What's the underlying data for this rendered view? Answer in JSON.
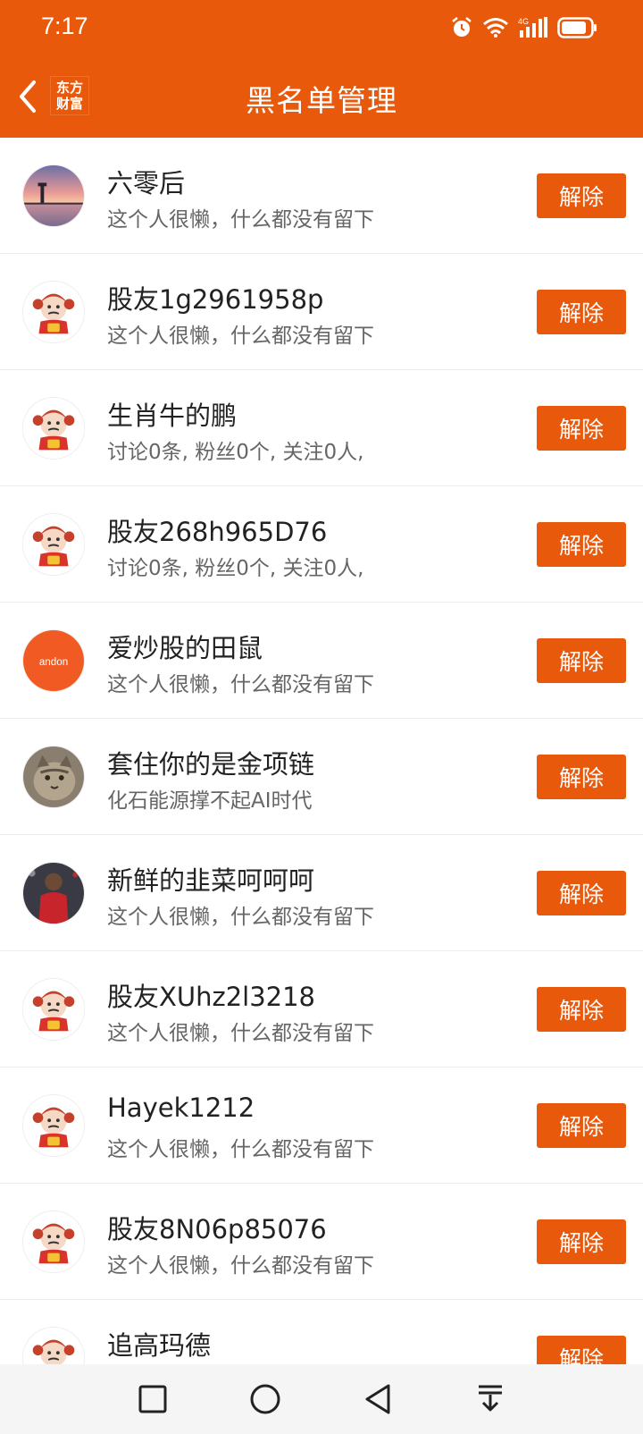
{
  "status_bar": {
    "time": "7:17",
    "network": "4G",
    "icons": [
      "alarm-icon",
      "wifi-icon",
      "signal-icon",
      "battery-icon"
    ]
  },
  "header": {
    "title": "黑名单管理",
    "brand_line1": "东方",
    "brand_line2": "财富",
    "accent_color": "#e8590b"
  },
  "blacklist": [
    {
      "name": "六零后",
      "desc": "这个人很懒，什么都没有留下",
      "button": "解除",
      "avatar": "sunset-photo"
    },
    {
      "name": "股友1g2961958p",
      "desc": "这个人很懒，什么都没有留下",
      "button": "解除",
      "avatar": "default-mascot"
    },
    {
      "name": "生肖牛的鹏",
      "desc": "讨论0条, 粉丝0个, 关注0人,",
      "button": "解除",
      "avatar": "default-mascot"
    },
    {
      "name": "股友268h965D76",
      "desc": "讨论0条, 粉丝0个, 关注0人,",
      "button": "解除",
      "avatar": "default-mascot"
    },
    {
      "name": "爱炒股的田鼠",
      "desc": "这个人很懒，什么都没有留下",
      "button": "解除",
      "avatar": "andon-logo"
    },
    {
      "name": "套住你的是金项链",
      "desc": "化石能源撑不起AI时代",
      "button": "解除",
      "avatar": "cat-photo"
    },
    {
      "name": "新鲜的韭菜呵呵呵",
      "desc": "这个人很懒，什么都没有留下",
      "button": "解除",
      "avatar": "player-photo"
    },
    {
      "name": "股友XUhz2l3218",
      "desc": "这个人很懒，什么都没有留下",
      "button": "解除",
      "avatar": "default-mascot"
    },
    {
      "name": "Hayek1212",
      "desc": "这个人很懒，什么都没有留下",
      "button": "解除",
      "avatar": "default-mascot"
    },
    {
      "name": "股友8N06p85076",
      "desc": "这个人很懒，什么都没有留下",
      "button": "解除",
      "avatar": "default-mascot"
    },
    {
      "name": "追高玛德",
      "desc": "",
      "button": "解除",
      "avatar": "default-mascot"
    }
  ],
  "andon_text": "andon",
  "bottom_nav": [
    "square-icon",
    "circle-icon",
    "triangle-back-icon",
    "download-icon"
  ]
}
